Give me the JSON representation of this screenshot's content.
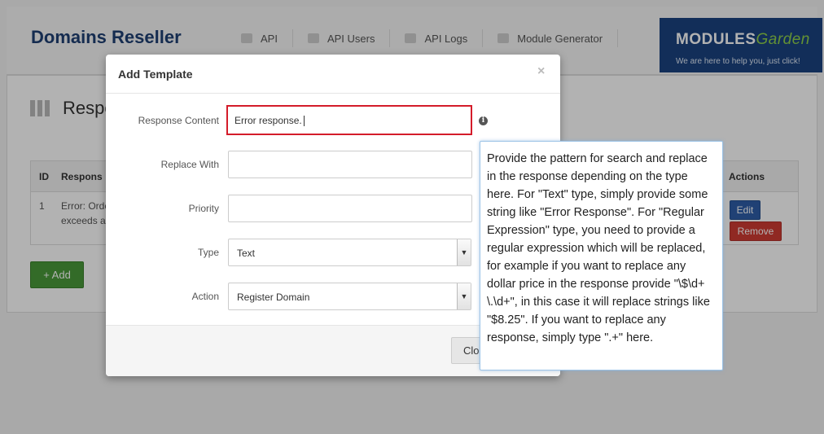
{
  "app": {
    "title": "Domains Reseller",
    "nav": [
      {
        "label": "API",
        "icon": "home-icon"
      },
      {
        "label": "API Users",
        "icon": "user-icon"
      },
      {
        "label": "API Logs",
        "icon": "list-icon"
      },
      {
        "label": "Module Generator",
        "icon": "file-icon"
      }
    ],
    "brand": {
      "logo_main": "MODULES",
      "logo_accent": "Garden",
      "tagline": "We are here to help you, just click!"
    },
    "page_title": "Respo",
    "table": {
      "headers": {
        "id": "ID",
        "response": "Respons",
        "actions": "Actions"
      },
      "rows": [
        {
          "id": "1",
          "response_line1": "Error: Orde",
          "response_line2": "exceeds a"
        }
      ],
      "edit_label": "Edit",
      "remove_label": "Remove"
    },
    "add_label": "+ Add"
  },
  "modal": {
    "title": "Add Template",
    "close_symbol": "×",
    "fields": {
      "response_content": {
        "label": "Response Content",
        "value": "Error response."
      },
      "replace_with": {
        "label": "Replace With",
        "value": ""
      },
      "priority": {
        "label": "Priority",
        "value": ""
      },
      "type": {
        "label": "Type",
        "selected": "Text"
      },
      "action": {
        "label": "Action",
        "selected": "Register Domain"
      }
    },
    "info_symbol": "i",
    "footer_close_label": "Clo"
  },
  "tooltip": {
    "text": "Provide the pattern for search and replace in the response depending on the type here. For \"Text\" type, simply provide some string like \"Error Response\". For \"Regular Expression\" type, you need to provide a regular expression which will be replaced, for example if you want to replace any dollar price in the response provide \"\\$\\d+ \\.\\d+\", in this case it will replace strings like \"$8.25\". If you want to replace any response, simply type \".+\" here."
  },
  "colors": {
    "brand_blue": "#1b4380",
    "title_blue": "#1f3f73",
    "edit_button": "#2f5ea8",
    "remove_button": "#cf3b33",
    "add_button": "#4a9a3a",
    "focus_border": "#d41c2a",
    "tooltip_border": "#9cc3e6"
  }
}
